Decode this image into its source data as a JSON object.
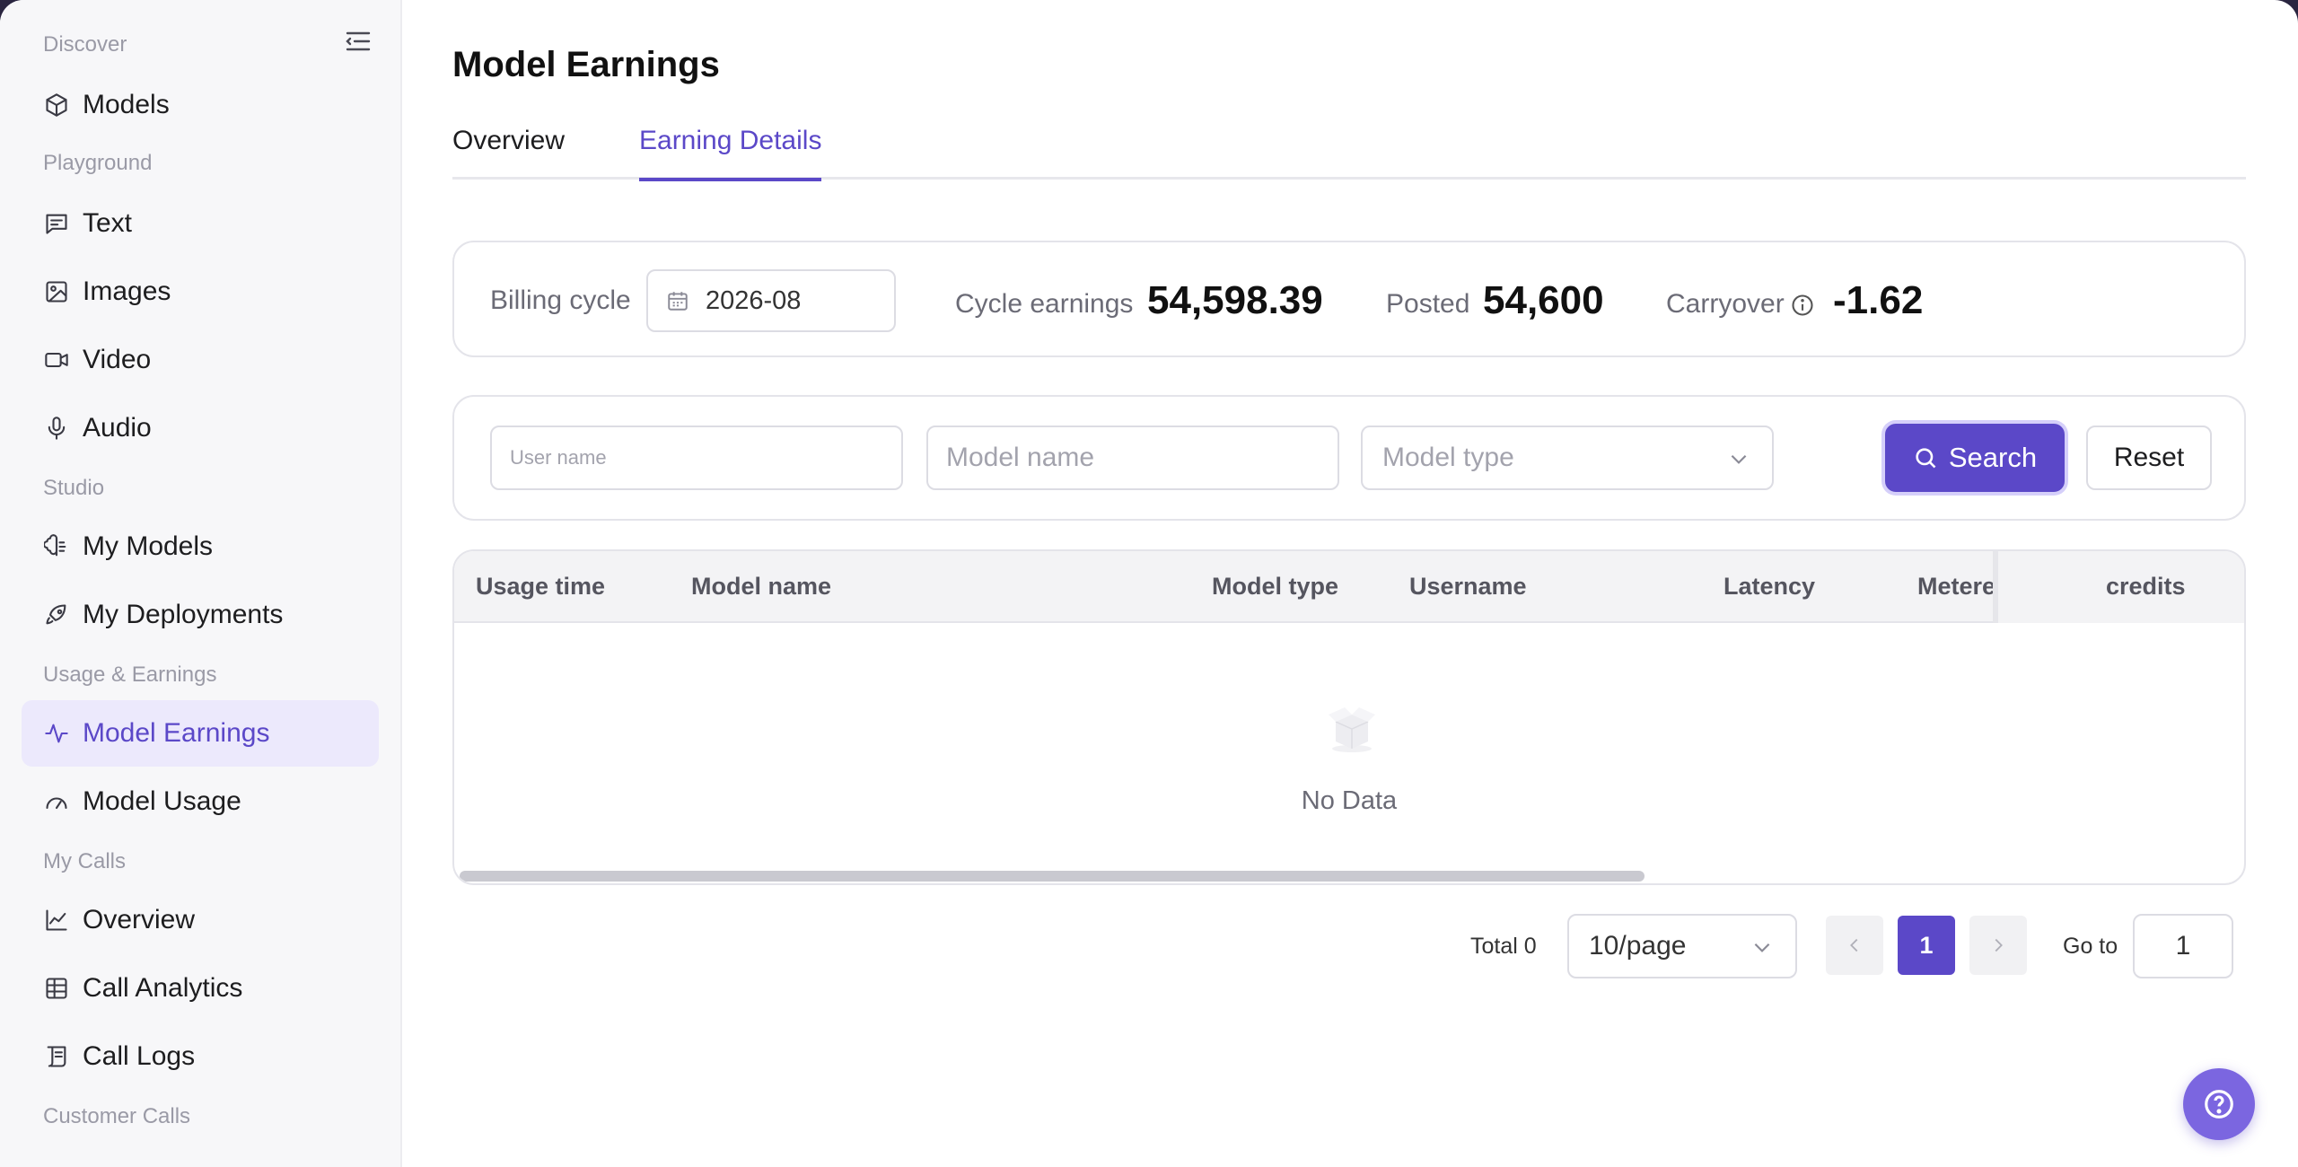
{
  "sidebar": {
    "sections": {
      "discover": "Discover",
      "playground": "Playground",
      "studio": "Studio",
      "usage": "Usage & Earnings",
      "calls": "My Calls",
      "customer": "Customer Calls"
    },
    "items": {
      "models": "Models",
      "text": "Text",
      "images": "Images",
      "video": "Video",
      "audio": "Audio",
      "my_models": "My Models",
      "my_deployments": "My Deployments",
      "model_earnings": "Model Earnings",
      "model_usage": "Model Usage",
      "overview": "Overview",
      "call_analytics": "Call Analytics",
      "call_logs": "Call Logs"
    },
    "active_item": "Model Earnings"
  },
  "page": {
    "title": "Model Earnings",
    "tabs": [
      "Overview",
      "Earning Details"
    ],
    "active_tab": "Earning Details"
  },
  "summary": {
    "billing_cycle_label": "Billing cycle",
    "billing_cycle_value": "2026-08",
    "cycle_earnings_label": "Cycle earnings",
    "cycle_earnings_value": "54,598.39",
    "posted_label": "Posted",
    "posted_value": "54,600",
    "carryover_label": "Carryover",
    "carryover_value": "-1.62"
  },
  "filters": {
    "user_name_placeholder": "User name",
    "model_name_placeholder": "Model name",
    "model_type_placeholder": "Model type",
    "search_label": "Search",
    "reset_label": "Reset"
  },
  "table": {
    "columns": [
      "Usage time",
      "Model name",
      "Model type",
      "Username",
      "Latency",
      "Metere",
      "credits"
    ],
    "rows": [],
    "empty_text": "No Data"
  },
  "pagination": {
    "total_text": "Total 0",
    "page_size": "10/page",
    "current_page": "1",
    "goto_label": "Go to",
    "goto_value": "1"
  },
  "colors": {
    "accent": "#5b48c8",
    "active_bg": "#ece9fc",
    "sidebar_bg": "#f7f7f9"
  }
}
